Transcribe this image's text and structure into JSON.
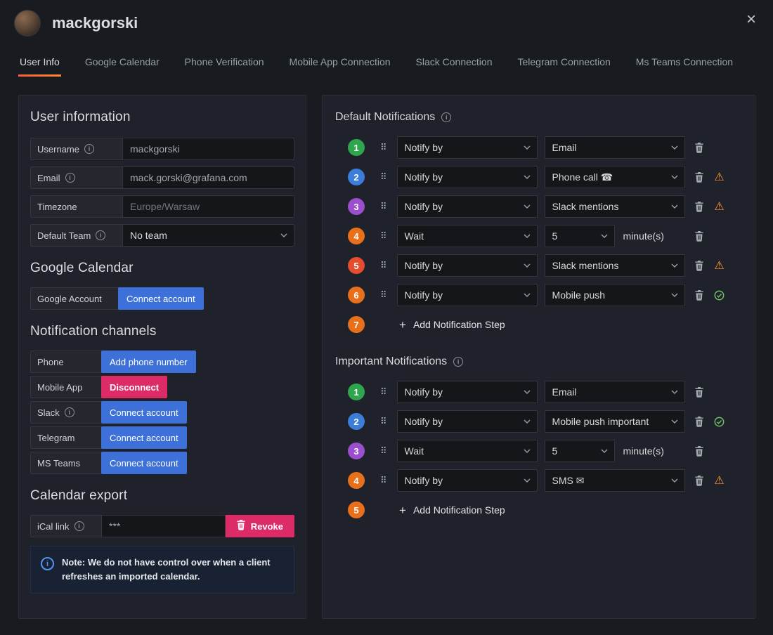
{
  "colors": {
    "primary_button": "#3d71d9",
    "destructive_button": "#dc2b66",
    "warning": "#ff9830",
    "success": "#73bf69",
    "tab_underline_start": "#f55f3e",
    "tab_underline_end": "#ff8833"
  },
  "header": {
    "title": "mackgorski",
    "close_icon": "×"
  },
  "tabs": [
    {
      "label": "User Info",
      "active": true
    },
    {
      "label": "Google Calendar",
      "active": false
    },
    {
      "label": "Phone Verification",
      "active": false
    },
    {
      "label": "Mobile App Connection",
      "active": false
    },
    {
      "label": "Slack Connection",
      "active": false
    },
    {
      "label": "Telegram Connection",
      "active": false
    },
    {
      "label": "Ms Teams Connection",
      "active": false
    }
  ],
  "user_info": {
    "heading": "User information",
    "fields": [
      {
        "label": "Username",
        "info": true,
        "value": "mackgorski",
        "type": "text",
        "muted": false
      },
      {
        "label": "Email",
        "info": true,
        "value": "mack.gorski@grafana.com",
        "type": "text",
        "muted": false
      },
      {
        "label": "Timezone",
        "info": false,
        "value": "Europe/Warsaw",
        "type": "text",
        "muted": true
      },
      {
        "label": "Default Team",
        "info": true,
        "value": "No team",
        "type": "select",
        "muted": false
      }
    ]
  },
  "google_calendar": {
    "heading": "Google Calendar",
    "rows": [
      {
        "label": "Google Account",
        "info": false,
        "button": "Connect account",
        "style": "primary"
      }
    ]
  },
  "notification_channels": {
    "heading": "Notification channels",
    "rows": [
      {
        "label": "Phone",
        "info": false,
        "button": "Add phone number",
        "style": "primary"
      },
      {
        "label": "Mobile App",
        "info": false,
        "button": "Disconnect",
        "style": "destructive"
      },
      {
        "label": "Slack",
        "info": true,
        "button": "Connect account",
        "style": "primary"
      },
      {
        "label": "Telegram",
        "info": false,
        "button": "Connect account",
        "style": "primary"
      },
      {
        "label": "MS Teams",
        "info": false,
        "button": "Connect account",
        "style": "primary"
      }
    ]
  },
  "calendar_export": {
    "heading": "Calendar export",
    "ical_label": "iCal link",
    "ical_info": true,
    "ical_value": "***",
    "revoke_label": "Revoke",
    "note_text": "Note: We do not have control over when a client refreshes an imported calendar."
  },
  "default_notifications": {
    "heading": "Default Notifications",
    "steps": [
      {
        "num": "1",
        "color": "#2fa64d",
        "type": "notify",
        "action": "Notify by",
        "channel": "Email",
        "status": "none"
      },
      {
        "num": "2",
        "color": "#3c7dd9",
        "type": "notify",
        "action": "Notify by",
        "channel": "Phone call ☎",
        "status": "warning"
      },
      {
        "num": "3",
        "color": "#9b4ece",
        "type": "notify",
        "action": "Notify by",
        "channel": "Slack mentions",
        "status": "warning"
      },
      {
        "num": "4",
        "color": "#e8701a",
        "type": "wait",
        "action": "Wait",
        "duration": "5",
        "unit": "minute(s)",
        "status": "none"
      },
      {
        "num": "5",
        "color": "#e54d2e",
        "type": "notify",
        "action": "Notify by",
        "channel": "Slack mentions",
        "status": "warning"
      },
      {
        "num": "6",
        "color": "#e8701a",
        "type": "notify",
        "action": "Notify by",
        "channel": "Mobile push",
        "status": "success"
      },
      {
        "num": "7",
        "color": "#e8701a",
        "type": "add",
        "label": "Add Notification Step"
      }
    ]
  },
  "important_notifications": {
    "heading": "Important Notifications",
    "steps": [
      {
        "num": "1",
        "color": "#2fa64d",
        "type": "notify",
        "action": "Notify by",
        "channel": "Email",
        "status": "none"
      },
      {
        "num": "2",
        "color": "#3c7dd9",
        "type": "notify",
        "action": "Notify by",
        "channel": "Mobile push important",
        "status": "success"
      },
      {
        "num": "3",
        "color": "#9b4ece",
        "type": "wait",
        "action": "Wait",
        "duration": "5",
        "unit": "minute(s)",
        "status": "none"
      },
      {
        "num": "4",
        "color": "#e8701a",
        "type": "notify",
        "action": "Notify by",
        "channel": "SMS ✉",
        "status": "warning"
      },
      {
        "num": "5",
        "color": "#e8701a",
        "type": "add",
        "label": "Add Notification Step"
      }
    ]
  },
  "icons": {
    "drag_glyph": "⠿",
    "warning_glyph": "⚠",
    "plus_glyph": "+",
    "info_glyph": "i"
  }
}
